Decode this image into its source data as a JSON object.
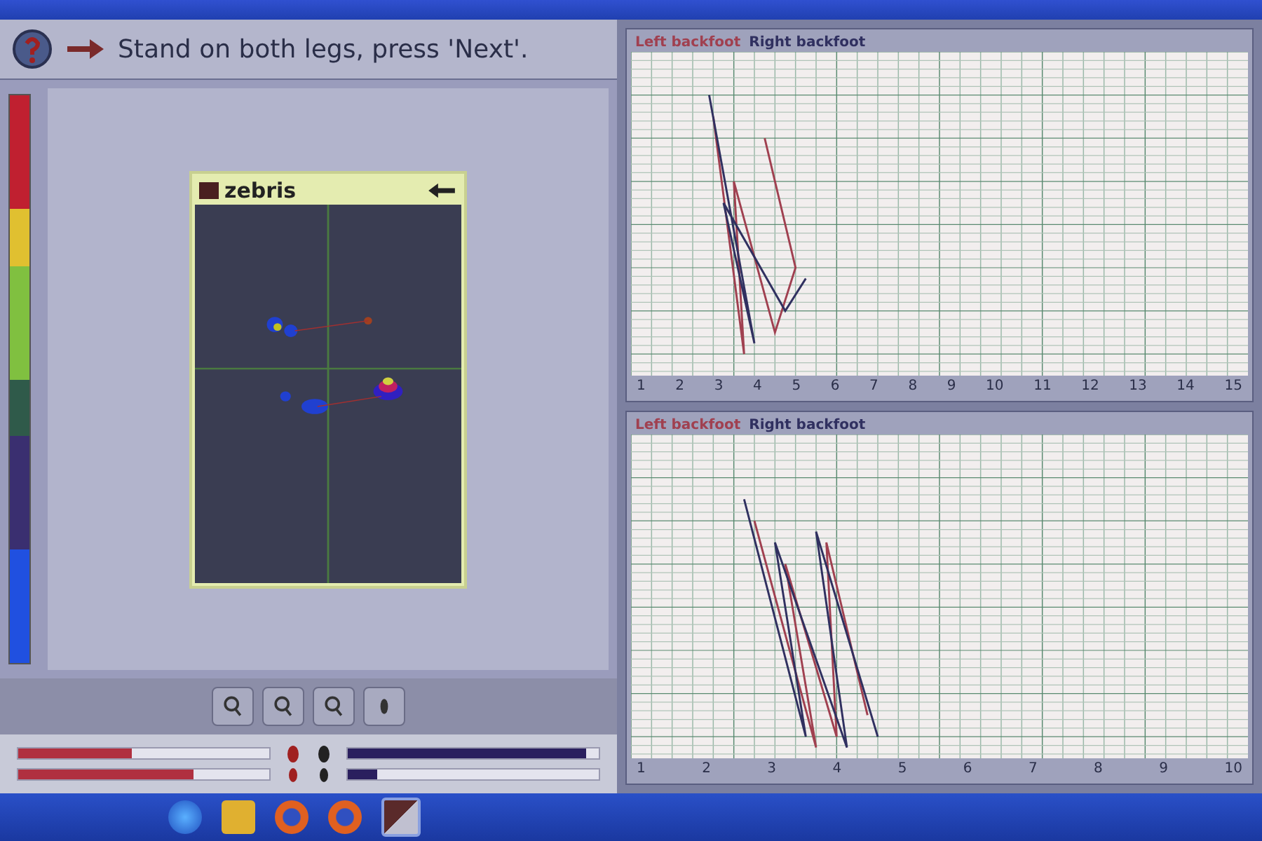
{
  "instruction": {
    "text": "Stand on both legs, press 'Next'."
  },
  "plate": {
    "brand": "zebris"
  },
  "charts": [
    {
      "legend": [
        {
          "label": "Left backfoot",
          "color": "#a04050"
        },
        {
          "label": "Right backfoot",
          "color": "#303060"
        }
      ],
      "x_tick_labels": [
        "1",
        "2",
        "3",
        "4",
        "5",
        "6",
        "7",
        "8",
        "9",
        "10",
        "11",
        "12",
        "13",
        "14",
        "15"
      ]
    },
    {
      "legend": [
        {
          "label": "Left backfoot",
          "color": "#a04050"
        },
        {
          "label": "Right backfoot",
          "color": "#303060"
        }
      ],
      "x_tick_labels": [
        "1",
        "2",
        "3",
        "4",
        "5",
        "6",
        "7",
        "8",
        "9",
        "10"
      ]
    }
  ],
  "left_bars": [
    {
      "level": 0.45
    },
    {
      "level": 0.7
    }
  ],
  "right_bars": [
    {
      "level": 0.95
    },
    {
      "level": 0.12
    }
  ]
}
